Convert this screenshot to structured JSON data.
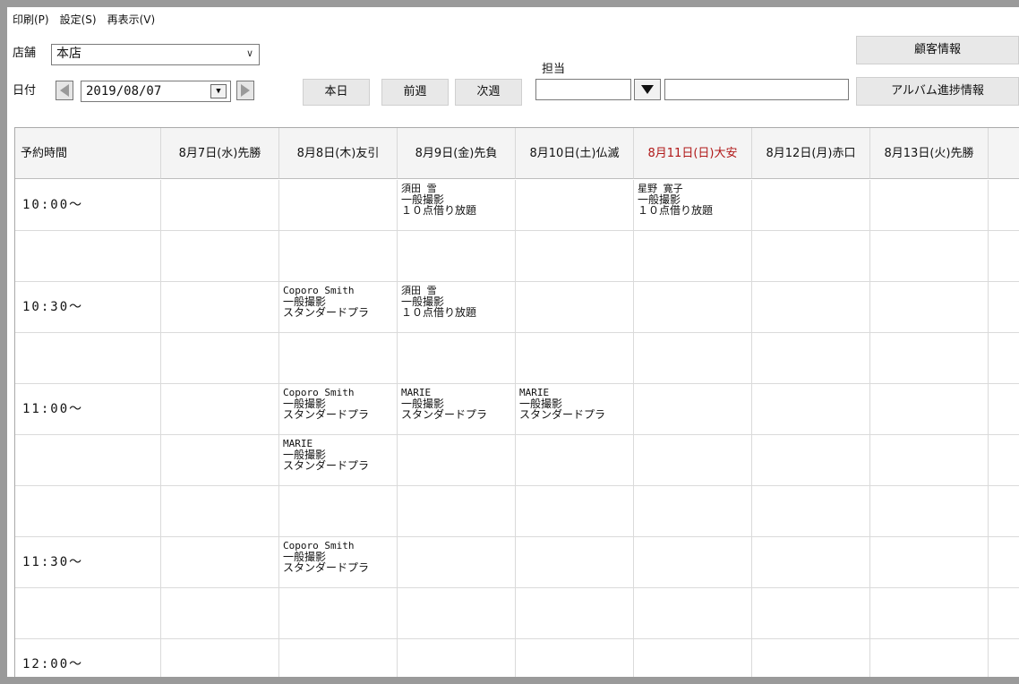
{
  "menu": [
    {
      "id": "print",
      "label": "印刷(P)"
    },
    {
      "id": "settings",
      "label": "設定(S)"
    },
    {
      "id": "refresh",
      "label": "再表示(V)"
    }
  ],
  "toolbar": {
    "store_label": "店舗",
    "store_value": "本店",
    "date_label": "日付",
    "date_value": "2019/08/07",
    "today_button": "本日",
    "prev_week_button": "前週",
    "next_week_button": "次週",
    "staff_label": "担当",
    "staff_value": "",
    "staff_name_value": "",
    "customer_info_button": "顧客情報",
    "album_progress_button": "アルバム進捗情報"
  },
  "schedule": {
    "columns": [
      "予約時間",
      "8月7日(水)先勝",
      "8月8日(木)友引",
      "8月9日(金)先負",
      "8月10日(土)仏滅",
      "8月11日(日)大安",
      "8月12日(月)赤口",
      "8月13日(火)先勝"
    ],
    "highlight_column": 5,
    "highlight_color": "#b01818",
    "rows": [
      {
        "time": "10:00～",
        "cells": [
          null,
          null,
          {
            "name": "須田 雪",
            "type": "一般撮影",
            "plan": "１０点借り放題"
          },
          null,
          {
            "name": "星野 寛子",
            "type": "一般撮影",
            "plan": "１０点借り放題"
          },
          null,
          null
        ]
      },
      {
        "time": "",
        "cells": [
          null,
          null,
          null,
          null,
          null,
          null,
          null
        ]
      },
      {
        "time": "10:30～",
        "cells": [
          null,
          {
            "name": "Coporo Smith",
            "type": "一般撮影",
            "plan": "スタンダードプラ"
          },
          {
            "name": "須田 雪",
            "type": "一般撮影",
            "plan": "１０点借り放題"
          },
          null,
          null,
          null,
          null
        ]
      },
      {
        "time": "",
        "cells": [
          null,
          null,
          null,
          null,
          null,
          null,
          null
        ]
      },
      {
        "time": "11:00～",
        "cells": [
          null,
          {
            "name": "Coporo Smith",
            "type": "一般撮影",
            "plan": "スタンダードプラ"
          },
          {
            "name": "MARIE",
            "type": "一般撮影",
            "plan": "スタンダードプラ"
          },
          {
            "name": "MARIE",
            "type": "一般撮影",
            "plan": "スタンダードプラ"
          },
          null,
          null,
          null
        ]
      },
      {
        "time": "",
        "cells": [
          null,
          {
            "name": "MARIE",
            "type": "一般撮影",
            "plan": "スタンダードプラ"
          },
          null,
          null,
          null,
          null,
          null
        ]
      },
      {
        "time": "",
        "cells": [
          null,
          null,
          null,
          null,
          null,
          null,
          null
        ]
      },
      {
        "time": "11:30～",
        "cells": [
          null,
          {
            "name": "Coporo Smith",
            "type": "一般撮影",
            "plan": "スタンダードプラ"
          },
          null,
          null,
          null,
          null,
          null
        ]
      },
      {
        "time": "",
        "cells": [
          null,
          null,
          null,
          null,
          null,
          null,
          null
        ]
      },
      {
        "time": "12:00～",
        "cells": [
          null,
          null,
          null,
          null,
          null,
          null,
          null
        ]
      }
    ]
  }
}
